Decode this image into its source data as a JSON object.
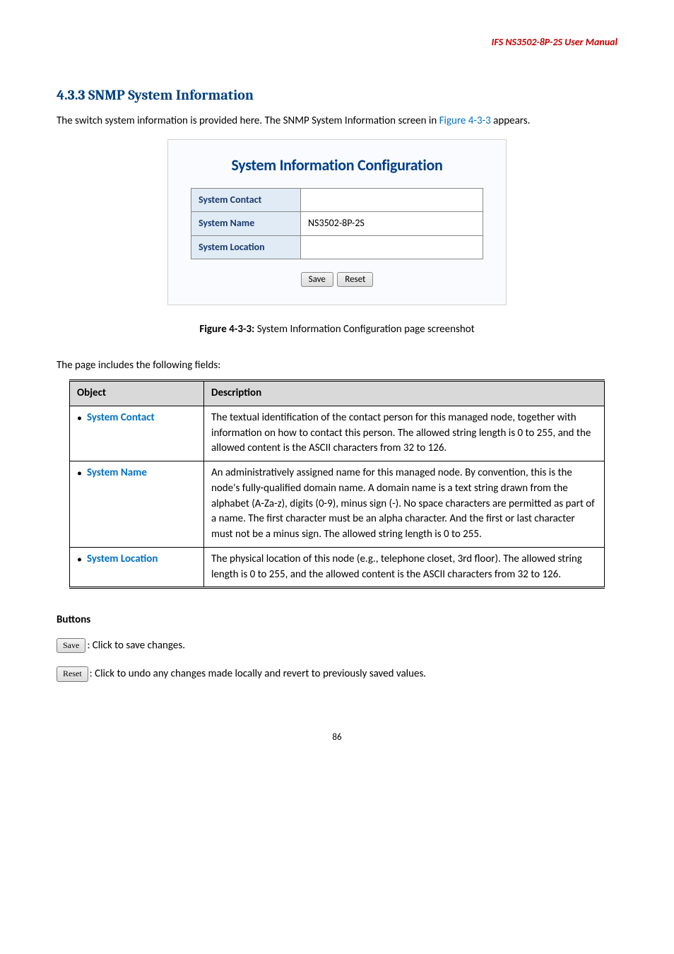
{
  "header": "IFS NS3502-8P-2S  User Manual",
  "section_heading": "4.3.3 SNMP System Information",
  "intro_text_1": "The switch system information is provided here. The SNMP System Information screen in ",
  "intro_link": "Figure 4-3-3",
  "intro_text_2": " appears.",
  "panel": {
    "title": "System Information Configuration",
    "rows": {
      "contact_label": "System Contact",
      "contact_value": "",
      "name_label": "System Name",
      "name_value": "NS3502-8P-2S",
      "location_label": "System Location",
      "location_value": ""
    },
    "save_btn": "Save",
    "reset_btn": "Reset"
  },
  "figure_caption_prefix": "Figure 4-3-3:",
  "figure_caption_rest": " System Information Configuration page screenshot",
  "fields_intro": "The page includes the following fields:",
  "table": {
    "h_object": "Object",
    "h_desc": "Description",
    "r1_name": "System Contact",
    "r1_desc": "The textual identification of the contact person for this managed node, together with information on how to contact this person. The allowed string length is 0 to 255, and the allowed content is the ASCII characters from 32 to 126.",
    "r2_name": "System Name",
    "r2_desc": "An administratively assigned name for this managed node. By convention, this is the node's fully-qualified domain name. A domain name is a text string drawn from the alphabet (A-Za-z), digits (0-9), minus sign (-). No space characters are permitted as part of a name. The first character must be an alpha character. And the first or last character must not be a minus sign. The allowed string length is 0 to 255.",
    "r3_name": "System Location",
    "r3_desc": "The physical location of this node (e.g., telephone closet, 3rd floor). The allowed string length is 0 to 255, and the allowed content is the ASCII characters from 32 to 126."
  },
  "buttons_heading": "Buttons",
  "save_btn_label": "Save",
  "save_btn_desc": ": Click to save changes.",
  "reset_btn_label": "Reset",
  "reset_btn_desc": ": Click to undo any changes made locally and revert to previously saved values.",
  "page_number": "86"
}
